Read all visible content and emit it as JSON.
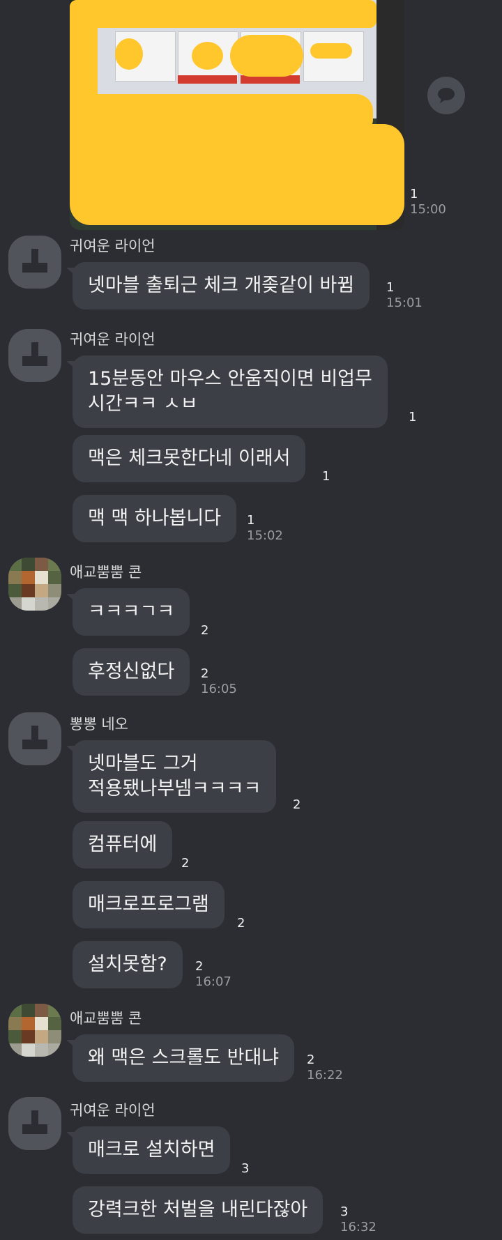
{
  "photo_message": {
    "read_count": "1",
    "time": "15:00"
  },
  "messages": [
    {
      "sender": "귀여운 라이언",
      "bubbles": [
        {
          "text": "넷마블 출퇴근 체크 개좆같이 바뀜",
          "read_count": "1",
          "time": "15:01"
        }
      ]
    },
    {
      "sender": "귀여운 라이언",
      "bubbles": [
        {
          "text": "15분동안 마우스 안움직이면 비업무\n시간ㅋㅋ ㅅㅂ",
          "read_count": "1",
          "time": ""
        },
        {
          "text": "맥은 체크못한다네 이래서",
          "read_count": "1",
          "time": ""
        },
        {
          "text": "맥 맥 하나봅니다",
          "read_count": "1",
          "time": "15:02"
        }
      ]
    },
    {
      "sender": "애교뿜뿜 콘",
      "bubbles": [
        {
          "text": "ㅋㅋㅋㄱㅋ",
          "read_count": "2",
          "time": ""
        },
        {
          "text": "후정신없다",
          "read_count": "2",
          "time": "16:05"
        }
      ]
    },
    {
      "sender": "뽕뽕 네오",
      "bubbles": [
        {
          "text": "넷마블도 그거\n적용됐나부넴ㅋㅋㅋㅋ",
          "read_count": "2",
          "time": ""
        },
        {
          "text": "컴퓨터에",
          "read_count": "2",
          "time": ""
        },
        {
          "text": "매크로프로그램",
          "read_count": "2",
          "time": ""
        },
        {
          "text": "설치못함?",
          "read_count": "2",
          "time": "16:07"
        }
      ]
    },
    {
      "sender": "애교뿜뿜 콘",
      "bubbles": [
        {
          "text": "왜 맥은 스크롤도 반대냐",
          "read_count": "2",
          "time": "16:22"
        }
      ]
    },
    {
      "sender": "귀여운 라이언",
      "bubbles": [
        {
          "text": "매크로 설치하면",
          "read_count": "3",
          "time": ""
        },
        {
          "text": "강력크한 처벌을 내린다잖아",
          "read_count": "3",
          "time": "16:32"
        }
      ]
    }
  ],
  "icons": {
    "share": "share-speech-icon",
    "avatar_default": "person-silhouette-icon"
  }
}
